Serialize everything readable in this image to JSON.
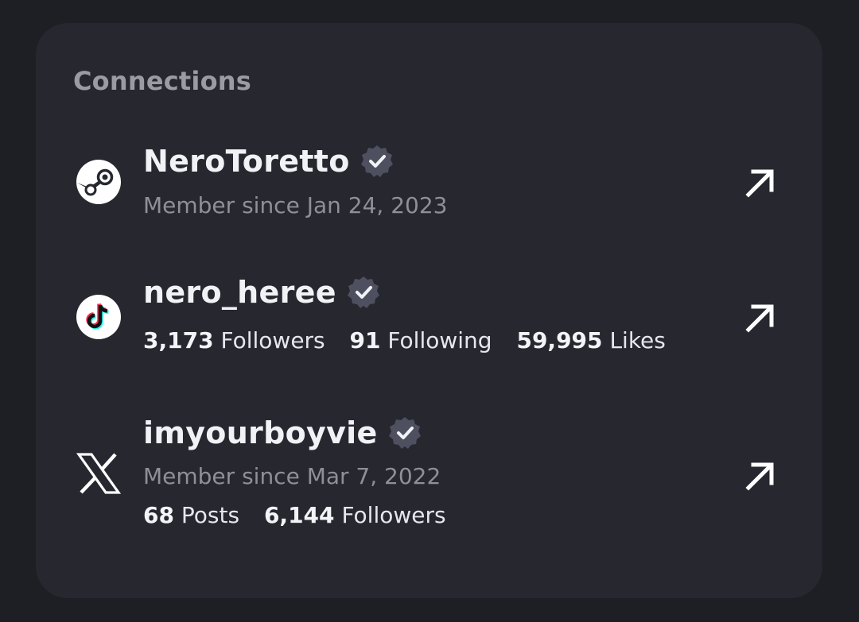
{
  "section": {
    "title": "Connections"
  },
  "connections": [
    {
      "platform": "Steam",
      "icon": "steam-icon",
      "name": "NeroToretto",
      "verified": true,
      "member_since": "Member since Jan 24, 2023"
    },
    {
      "platform": "TikTok",
      "icon": "tiktok-icon",
      "name": "nero_heree",
      "verified": true,
      "stats": [
        {
          "value": "3,173",
          "label": "Followers"
        },
        {
          "value": "91",
          "label": "Following"
        },
        {
          "value": "59,995",
          "label": "Likes"
        }
      ]
    },
    {
      "platform": "X",
      "icon": "x-logo-icon",
      "name": "imyourboyvie",
      "verified": true,
      "member_since": "Member since Mar 7, 2022",
      "stats": [
        {
          "value": "68",
          "label": "Posts"
        },
        {
          "value": "6,144",
          "label": "Followers"
        }
      ]
    }
  ],
  "colors": {
    "background": "#1e1f25",
    "card": "#26272f",
    "text_primary": "#f1f2f5",
    "text_secondary": "#8e8f99",
    "verified_badge": "#4e5060"
  }
}
